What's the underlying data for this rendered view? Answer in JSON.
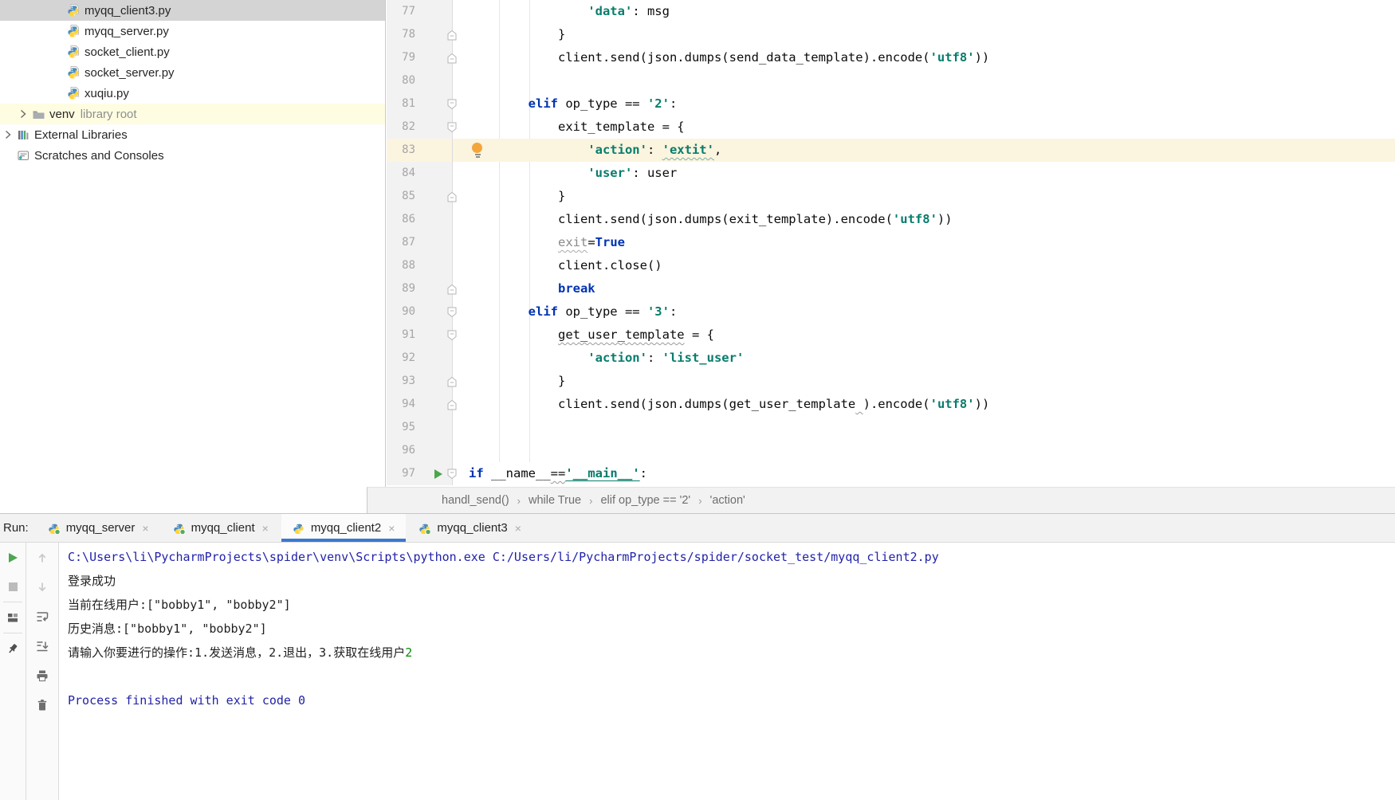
{
  "colors": {
    "accent_blue": "#3B78CF",
    "selected_row": "#D4D4D4",
    "venv_row_highlight": "#FFFDE1",
    "current_line": "#FBF4DF",
    "keyword": "#0033B3",
    "string": "#077D6C",
    "console_system": "#2222AA",
    "console_input_green": "#0B8A0B",
    "run_arrow_green": "#4CA64C"
  },
  "project_tree": {
    "items": [
      {
        "label": "myqq_client3.py",
        "icon": "python-file-icon",
        "level": 3,
        "selected": true,
        "chevron": false
      },
      {
        "label": "myqq_server.py",
        "icon": "python-file-icon",
        "level": 3,
        "selected": false,
        "chevron": false
      },
      {
        "label": "socket_client.py",
        "icon": "python-file-icon",
        "level": 3,
        "selected": false,
        "chevron": false
      },
      {
        "label": "socket_server.py",
        "icon": "python-file-icon",
        "level": 3,
        "selected": false,
        "chevron": false
      },
      {
        "label": "xuqiu.py",
        "icon": "python-file-icon",
        "level": 3,
        "selected": false,
        "chevron": false
      },
      {
        "label": "venv",
        "sublabel": "library root",
        "icon": "folder-icon",
        "level": 2,
        "selected": false,
        "chevron": true,
        "highlighted": true
      },
      {
        "label": "External Libraries",
        "icon": "libraries-icon",
        "level": 1,
        "selected": false,
        "chevron": true
      },
      {
        "label": "Scratches and Consoles",
        "icon": "scratches-icon",
        "level": 1,
        "selected": false,
        "chevron": false
      }
    ]
  },
  "editor": {
    "lines": [
      {
        "n": 77,
        "i": 16,
        "t": [
          [
            "s",
            "'data'"
          ],
          [
            "d",
            ": msg"
          ]
        ]
      },
      {
        "n": 78,
        "i": 12,
        "t": [
          [
            "d",
            "}"
          ]
        ],
        "f": "up"
      },
      {
        "n": 79,
        "i": 12,
        "t": [
          [
            "d",
            "client.send(json.dumps(send_data_template).encode("
          ],
          [
            "s",
            "'utf8'"
          ],
          [
            "d",
            "))"
          ]
        ],
        "f": "up"
      },
      {
        "n": 80,
        "i": 0,
        "t": []
      },
      {
        "n": 81,
        "i": 8,
        "t": [
          [
            "k",
            "elif"
          ],
          [
            "d",
            " op_type == "
          ],
          [
            "s",
            "'2'"
          ],
          [
            "d",
            ":"
          ]
        ],
        "f": "down"
      },
      {
        "n": 82,
        "i": 12,
        "t": [
          [
            "d",
            "exit_template = {"
          ]
        ],
        "f": "down"
      },
      {
        "n": 83,
        "i": 16,
        "t": [
          [
            "s",
            "'action'"
          ],
          [
            "d",
            ": "
          ],
          [
            "sw",
            "'extit'"
          ],
          [
            "d",
            ","
          ]
        ],
        "hl": true,
        "bulb": true
      },
      {
        "n": 84,
        "i": 16,
        "t": [
          [
            "s",
            "'user'"
          ],
          [
            "d",
            ": user"
          ]
        ]
      },
      {
        "n": 85,
        "i": 12,
        "t": [
          [
            "d",
            "}"
          ]
        ],
        "f": "up"
      },
      {
        "n": 86,
        "i": 12,
        "t": [
          [
            "d",
            "client.send(json.dumps(exit_template).encode("
          ],
          [
            "s",
            "'utf8'"
          ],
          [
            "d",
            "))"
          ]
        ]
      },
      {
        "n": 87,
        "i": 12,
        "t": [
          [
            "gw",
            "exit"
          ],
          [
            "d",
            "="
          ],
          [
            "k",
            "True"
          ]
        ]
      },
      {
        "n": 88,
        "i": 12,
        "t": [
          [
            "d",
            "client.close()"
          ]
        ]
      },
      {
        "n": 89,
        "i": 12,
        "t": [
          [
            "k",
            "break"
          ]
        ],
        "f": "up"
      },
      {
        "n": 90,
        "i": 8,
        "t": [
          [
            "k",
            "elif"
          ],
          [
            "d",
            " op_type == "
          ],
          [
            "s",
            "'3'"
          ],
          [
            "d",
            ":"
          ]
        ],
        "f": "down"
      },
      {
        "n": 91,
        "i": 12,
        "t": [
          [
            "dw",
            "get_user_template"
          ],
          [
            "d",
            " = {"
          ]
        ],
        "f": "down"
      },
      {
        "n": 92,
        "i": 16,
        "t": [
          [
            "s",
            "'action'"
          ],
          [
            "d",
            ": "
          ],
          [
            "s",
            "'list_user'"
          ]
        ]
      },
      {
        "n": 93,
        "i": 12,
        "t": [
          [
            "d",
            "}"
          ]
        ],
        "f": "up"
      },
      {
        "n": 94,
        "i": 12,
        "t": [
          [
            "d",
            "client.send(json.dumps(get_user_template"
          ],
          [
            "dw",
            " "
          ],
          [
            "d",
            ").encode("
          ],
          [
            "s",
            "'utf8'"
          ],
          [
            "d",
            "))"
          ]
        ],
        "f": "up"
      },
      {
        "n": 95,
        "i": 0,
        "t": []
      },
      {
        "n": 96,
        "i": 0,
        "t": []
      },
      {
        "n": 97,
        "i": 0,
        "t": [
          [
            "k",
            "if"
          ],
          [
            "d",
            " __name__"
          ],
          [
            "dw",
            "=="
          ],
          [
            "su",
            "'__main__'"
          ],
          [
            "d",
            ":"
          ]
        ],
        "f": "down",
        "run": true
      }
    ]
  },
  "breadcrumbs": {
    "items": [
      "handl_send()",
      "while True",
      "elif op_type == '2'",
      "'action'"
    ],
    "separator": "›"
  },
  "run_panel": {
    "label": "Run:",
    "tabs": [
      {
        "label": "myqq_server",
        "running": true,
        "selected": false,
        "close": "×"
      },
      {
        "label": "myqq_client",
        "running": true,
        "selected": false,
        "close": "×"
      },
      {
        "label": "myqq_client2",
        "running": false,
        "selected": true,
        "close": "×"
      },
      {
        "label": "myqq_client3",
        "running": true,
        "selected": false,
        "close": "×"
      }
    ]
  },
  "console": {
    "toolbar_left": [
      "rerun-icon",
      "stop-icon",
      "divider",
      "restore-layout-icon",
      "divider",
      "pin-tab-icon"
    ],
    "toolbar_right": [
      "up-stack-trace-icon",
      "down-stack-trace-icon",
      "soft-wrap-icon",
      "scroll-to-end-icon",
      "print-icon",
      "clear-all-icon"
    ],
    "lines": [
      {
        "cls": "sys",
        "text": "C:\\Users\\li\\PycharmProjects\\spider\\venv\\Scripts\\python.exe C:/Users/li/PycharmProjects/spider/socket_test/myqq_client2.py"
      },
      {
        "cls": "out",
        "text": "登录成功"
      },
      {
        "cls": "out",
        "text": "当前在线用户:[\"bobby1\", \"bobby2\"]"
      },
      {
        "cls": "out",
        "text": "历史消息:[\"bobby1\", \"bobby2\"]"
      },
      {
        "cls": "out",
        "text": "请输入你要进行的操作:1.发送消息，2.退出，3.获取在线用户",
        "input": "2"
      },
      {
        "cls": "out",
        "text": ""
      },
      {
        "cls": "sys",
        "text": "Process finished with exit code 0"
      }
    ]
  }
}
